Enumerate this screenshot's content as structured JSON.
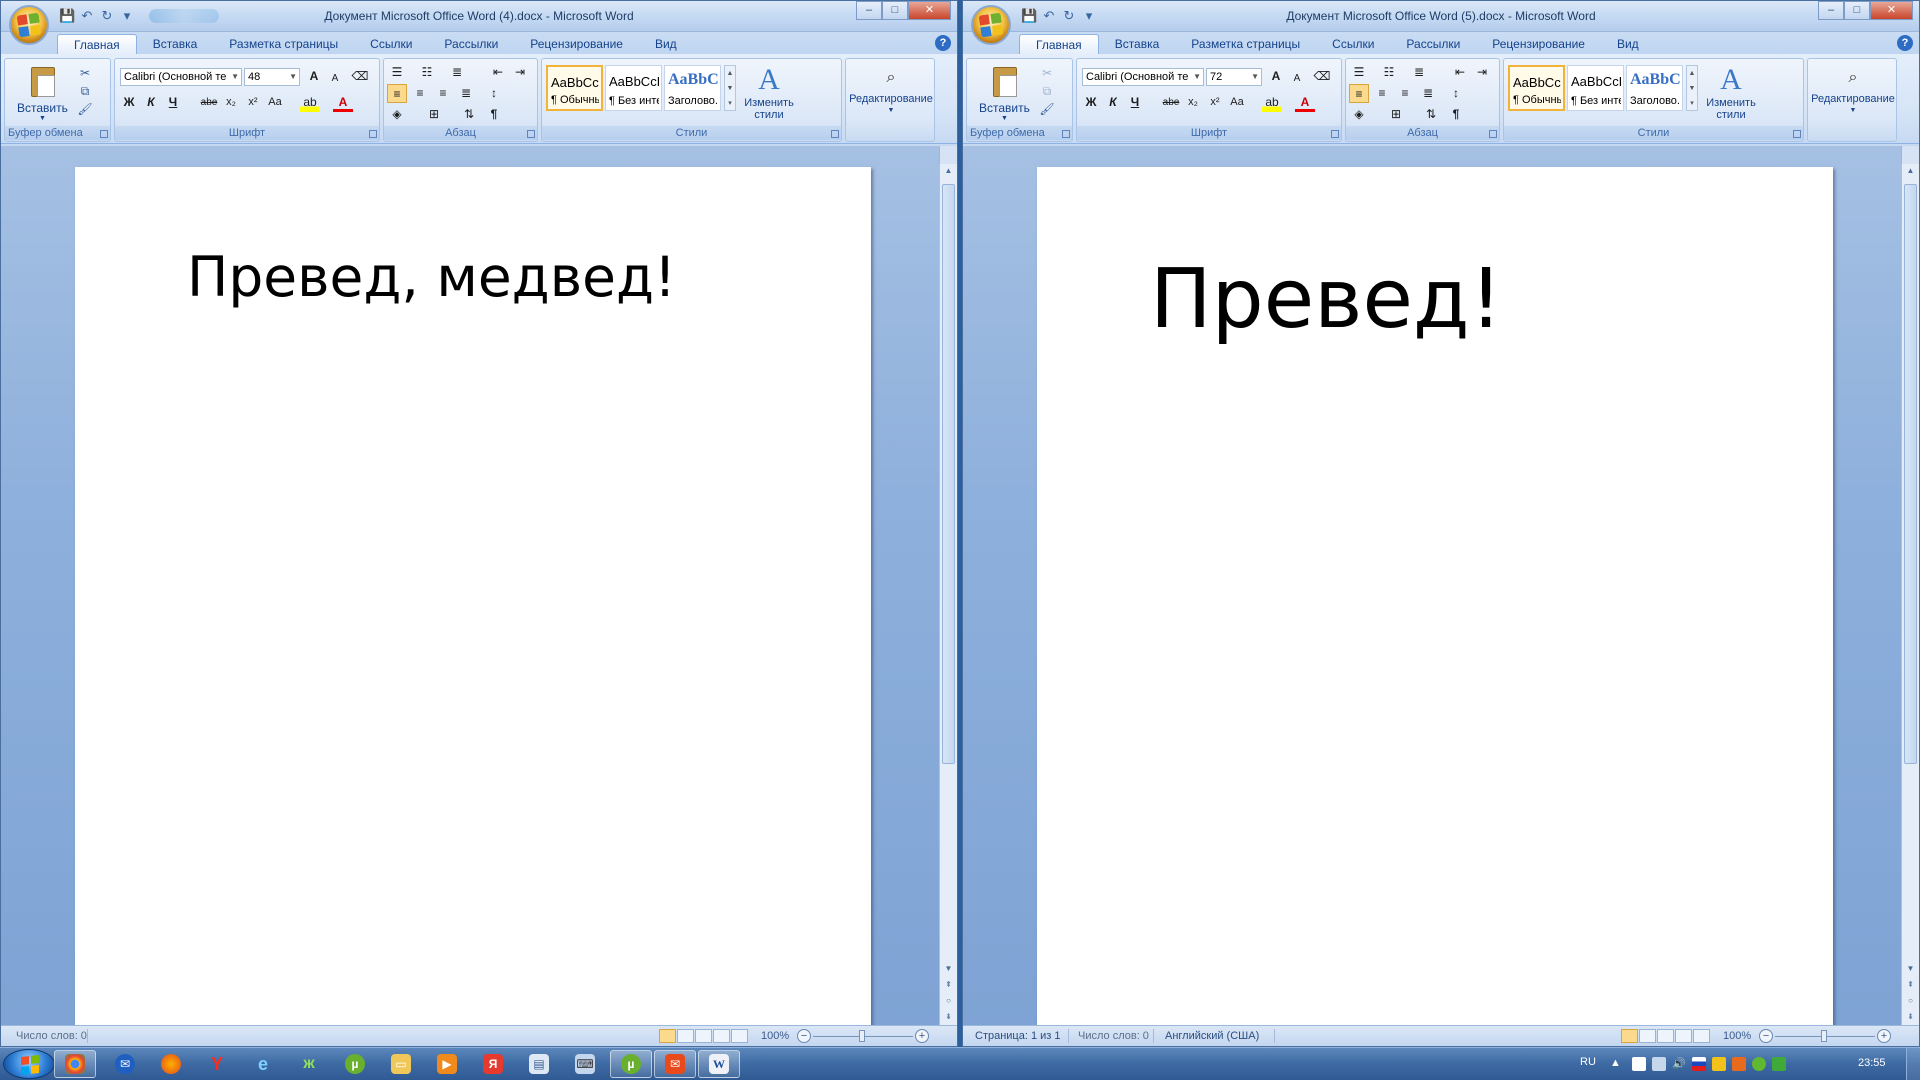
{
  "windows": [
    {
      "id": "left",
      "title": "Документ Microsoft Office Word (4).docx - Microsoft Word",
      "font_name": "Calibri (Основной те",
      "font_size": "48",
      "document_text": "Превед, медвед!",
      "status": {
        "words": "Число слов: 0",
        "zoom": "100%"
      }
    },
    {
      "id": "right",
      "title": "Документ Microsoft Office Word (5).docx - Microsoft Word",
      "font_name": "Calibri (Основной те",
      "font_size": "72",
      "document_text": "Превед!",
      "status": {
        "page": "Страница: 1 из 1",
        "words": "Число слов: 0",
        "language": "Английский (США)",
        "zoom": "100%"
      }
    }
  ],
  "ribbon": {
    "tabs": [
      "Главная",
      "Вставка",
      "Разметка страницы",
      "Ссылки",
      "Рассылки",
      "Рецензирование",
      "Вид"
    ],
    "groups": {
      "clipboard": "Буфер обмена",
      "font": "Шрифт",
      "paragraph": "Абзац",
      "styles": "Стили"
    },
    "paste_label": "Вставить",
    "styles_gallery": [
      {
        "sample": "AaBbCcDc",
        "name": "¶ Обычный"
      },
      {
        "sample": "AaBbCcDc",
        "name": "¶ Без инте..."
      },
      {
        "sample": "AaBbC",
        "name": "Заголово..."
      }
    ],
    "change_styles_line1": "Изменить",
    "change_styles_line2": "стили",
    "editing_label": "Редактирование",
    "font_buttons": {
      "bold": "Ж",
      "italic": "К",
      "underline": "Ч",
      "strike": "abe",
      "sub": "x₂",
      "sup": "x²",
      "case": "Aa",
      "grow": "A",
      "shrink": "A"
    },
    "help": "?"
  },
  "window_controls": {
    "minimize": "–",
    "maximize": "□",
    "close": "✕"
  },
  "taskbar": {
    "language": "RU",
    "clock": "23:55",
    "pinned_icons": [
      "chrome-icon",
      "thunderbird-icon",
      "firefox-icon",
      "yandex-browser-icon",
      "ie-icon",
      "butterfly-icon",
      "utorrent-icon",
      "explorer-icon",
      "media-player-icon",
      "yandex-icon",
      "notepad-icon",
      "keyboard-icon",
      "utorrent-active-icon",
      "mail-icon",
      "word-icon"
    ]
  },
  "colors": {
    "ribbon_bg": "#dbe7f7",
    "title_text": "#1f3d66",
    "tab_text": "#15428b",
    "workspace": "#8eb0dc",
    "taskbar": "#3e6aa3"
  }
}
